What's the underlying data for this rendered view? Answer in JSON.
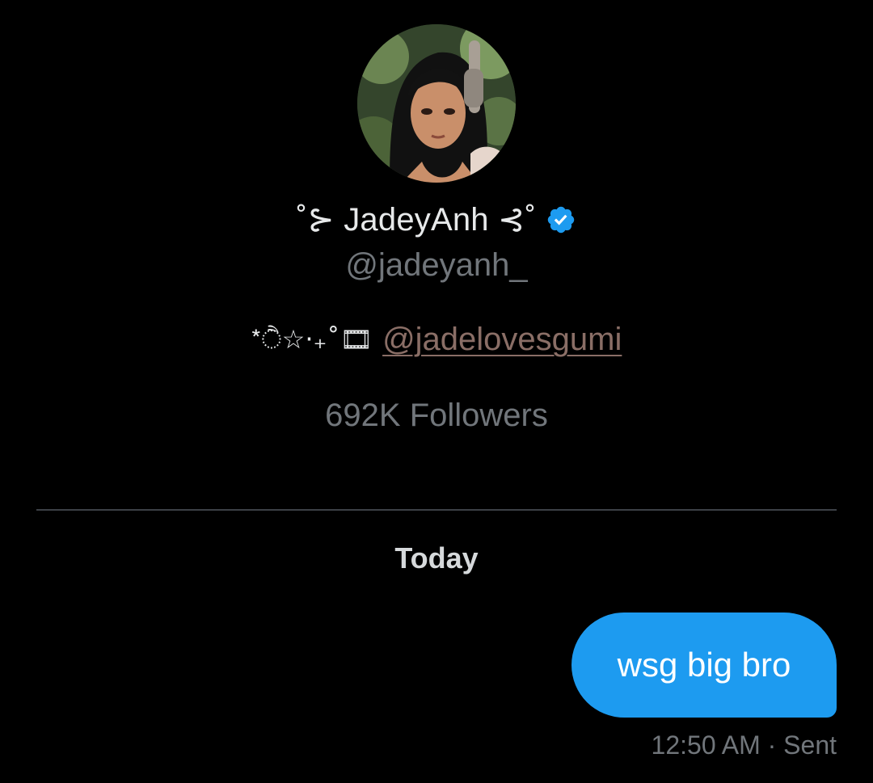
{
  "profile": {
    "display_name": "˚⊱ JadeyAnh ⊰˚",
    "handle": "@jadeyanh_",
    "verified": true,
    "bio_prefix": "*ੈ☆‧₊˚🎞",
    "bio_link": "@jadelovesgumi",
    "followers": "692K Followers",
    "avatar_icon": "avatar-anime-girl-headphones"
  },
  "conversation": {
    "date_label": "Today",
    "messages": [
      {
        "text": "wsg big bro",
        "time": "12:50 AM",
        "separator": "·",
        "status": "Sent",
        "meta": "12:50 AM · Sent"
      }
    ]
  },
  "colors": {
    "background": "#000000",
    "bubble": "#1d9bf0",
    "verified_badge": "#1d9bf0",
    "secondary_text": "#71767b",
    "link": "#8a6e66"
  }
}
